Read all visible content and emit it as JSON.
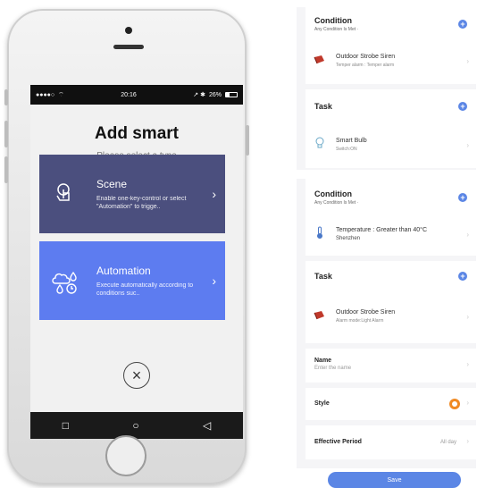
{
  "phone": {
    "statusbar": {
      "carrier": "●●●●○",
      "wifi": "⌔",
      "time": "20:16",
      "location_bt": "↗ ✱",
      "battery": "26%"
    },
    "title": "Add smart",
    "subtitle": "Please select a type",
    "cards": [
      {
        "title": "Scene",
        "desc": "Enable one-key-control or select \"Automation\" to trigge..",
        "icon": "touch-icon"
      },
      {
        "title": "Automation",
        "desc": "Execute automatically according to conditions suc..",
        "icon": "weather-clock-icon"
      }
    ],
    "close_icon": "×",
    "navbar": {
      "square": "□",
      "circle": "○",
      "back": "◁"
    }
  },
  "panel_top": {
    "condition": {
      "title": "Condition",
      "sub": "Any Condition Is Met  ·",
      "item_main": "Outdoor Strobe Siren",
      "item_sub": "Temper alarm : Temper alarm"
    },
    "task": {
      "title": "Task",
      "item_main": "Smart Bulb",
      "item_sub": "Switch:ON"
    }
  },
  "panel_bottom": {
    "condition": {
      "title": "Condition",
      "sub": "Any Condition Is Met  ·",
      "item_main": "Temperature : Greater than 40°C",
      "item_sub": "Shenzhen"
    },
    "task": {
      "title": "Task",
      "item_main": "Outdoor Strobe Siren",
      "item_sub": "Alarm mode:Light Alarm"
    },
    "name": {
      "label": "Name",
      "placeholder": "Enter the name"
    },
    "style": {
      "label": "Style"
    },
    "period": {
      "label": "Effective Period",
      "value": "All day"
    },
    "save": "Save"
  },
  "colors": {
    "scene": "#4b4f7e",
    "automation": "#5d7cf0",
    "accent": "#5b86e5"
  }
}
